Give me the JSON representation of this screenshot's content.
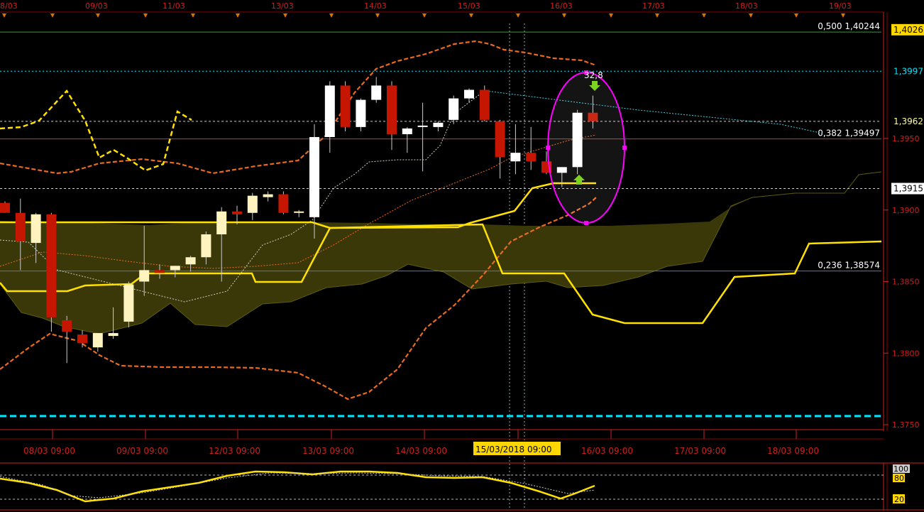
{
  "top_dates": [
    "8/03",
    "09/03",
    "11/03",
    "13/03",
    "14/03",
    "15/03",
    "16/03",
    "17/03",
    "18/03",
    "19/03"
  ],
  "bottom_dates": [
    "08/03 09:00",
    "09/03 09:00",
    "12/03 09:00",
    "13/03 09:00",
    "14/03 09:00",
    "15/03/2018 09:00",
    "16/03 09:00",
    "17/03 09:00",
    "18/03 09:00"
  ],
  "highlighted_date": "15/03/2018 09:00",
  "price_axis": {
    "ticks": [
      "1,3750",
      "1,3800",
      "1,3850",
      "1,3900",
      "1,3950"
    ],
    "tick_values": [
      1.375,
      1.38,
      1.385,
      1.39,
      1.395
    ],
    "ylim": [
      1.3745,
      1.4035
    ],
    "badges": [
      {
        "label": "1,4026",
        "value": 1.4026,
        "bg": "#ffd700",
        "fg": "#000000"
      },
      {
        "label": "1,3997",
        "value": 1.3997,
        "bg": "#000000",
        "fg": "#00e5ff"
      },
      {
        "label": "1,3962",
        "value": 1.3962,
        "bg": "#000000",
        "fg": "#ffff99"
      },
      {
        "label": "1,3915",
        "value": 1.3915,
        "bg": "#ffffff",
        "fg": "#000000"
      }
    ]
  },
  "fib_levels": [
    {
      "label": "0,500 1,40244",
      "value": 1.40244,
      "color": "#2ea02e"
    },
    {
      "label": "0,382 1,39497",
      "value": 1.39497,
      "color": "#d0342c"
    },
    {
      "label": "0,236 1,38574",
      "value": 1.38574,
      "color": "#5a6fd0"
    }
  ],
  "horizontal_lines": [
    {
      "value": 1.3997,
      "color": "#00e5ff",
      "style": "dotted"
    },
    {
      "value": 1.3962,
      "color": "#ffffff",
      "style": "dashed"
    },
    {
      "value": 1.3915,
      "color": "#ffffff",
      "style": "dashed"
    },
    {
      "value": 1.3756,
      "color": "#00e5ff",
      "style": "dashed-thick"
    }
  ],
  "annotation": {
    "text": "32,8",
    "color": "#ff00ff"
  },
  "chart_data": {
    "type": "candlestick",
    "timeframe": "4h",
    "candles": [
      {
        "x": 1,
        "o": 1.3905,
        "h": 1.3906,
        "l": 1.3898,
        "c": 1.3898
      },
      {
        "x": 2,
        "o": 1.3898,
        "h": 1.3908,
        "l": 1.3858,
        "c": 1.3878
      },
      {
        "x": 3,
        "o": 1.3877,
        "h": 1.3898,
        "l": 1.3863,
        "c": 1.3897
      },
      {
        "x": 4,
        "o": 1.3897,
        "h": 1.3898,
        "l": 1.3815,
        "c": 1.3825
      },
      {
        "x": 5,
        "o": 1.3823,
        "h": 1.3826,
        "l": 1.3793,
        "c": 1.3815
      },
      {
        "x": 6,
        "o": 1.3813,
        "h": 1.3816,
        "l": 1.3804,
        "c": 1.3807
      },
      {
        "x": 7,
        "o": 1.3804,
        "h": 1.3814,
        "l": 1.3801,
        "c": 1.3814
      },
      {
        "x": 8,
        "o": 1.3812,
        "h": 1.3832,
        "l": 1.381,
        "c": 1.3814
      },
      {
        "x": 9,
        "o": 1.3822,
        "h": 1.385,
        "l": 1.3818,
        "c": 1.3848
      },
      {
        "x": 10,
        "o": 1.385,
        "h": 1.3889,
        "l": 1.384,
        "c": 1.3858
      },
      {
        "x": 11,
        "o": 1.3858,
        "h": 1.3862,
        "l": 1.3852,
        "c": 1.3856
      },
      {
        "x": 12,
        "o": 1.3858,
        "h": 1.3861,
        "l": 1.3853,
        "c": 1.3861
      },
      {
        "x": 13,
        "o": 1.3862,
        "h": 1.3868,
        "l": 1.3857,
        "c": 1.3867
      },
      {
        "x": 14,
        "o": 1.3867,
        "h": 1.3885,
        "l": 1.3862,
        "c": 1.3883
      },
      {
        "x": 15,
        "o": 1.3883,
        "h": 1.3902,
        "l": 1.385,
        "c": 1.3899
      },
      {
        "x": 16,
        "o": 1.3899,
        "h": 1.3903,
        "l": 1.389,
        "c": 1.3897
      },
      {
        "x": 17,
        "o": 1.3898,
        "h": 1.3912,
        "l": 1.3893,
        "c": 1.391
      },
      {
        "x": 18,
        "o": 1.3909,
        "h": 1.3913,
        "l": 1.3906,
        "c": 1.3911
      },
      {
        "x": 19,
        "o": 1.3911,
        "h": 1.3913,
        "l": 1.3897,
        "c": 1.3898
      },
      {
        "x": 20,
        "o": 1.3898,
        "h": 1.39,
        "l": 1.3895,
        "c": 1.3899
      },
      {
        "x": 21,
        "o": 1.3895,
        "h": 1.396,
        "l": 1.388,
        "c": 1.3951
      },
      {
        "x": 22,
        "o": 1.3951,
        "h": 1.399,
        "l": 1.394,
        "c": 1.3987
      },
      {
        "x": 23,
        "o": 1.3987,
        "h": 1.399,
        "l": 1.3955,
        "c": 1.3958
      },
      {
        "x": 24,
        "o": 1.3958,
        "h": 1.3978,
        "l": 1.3955,
        "c": 1.3977
      },
      {
        "x": 25,
        "o": 1.3977,
        "h": 1.3993,
        "l": 1.3975,
        "c": 1.3987
      },
      {
        "x": 26,
        "o": 1.3987,
        "h": 1.399,
        "l": 1.3942,
        "c": 1.3953
      },
      {
        "x": 27,
        "o": 1.3953,
        "h": 1.3958,
        "l": 1.394,
        "c": 1.3957
      },
      {
        "x": 28,
        "o": 1.3958,
        "h": 1.3975,
        "l": 1.3927,
        "c": 1.3959
      },
      {
        "x": 29,
        "o": 1.3958,
        "h": 1.3962,
        "l": 1.3955,
        "c": 1.3961
      },
      {
        "x": 30,
        "o": 1.3963,
        "h": 1.398,
        "l": 1.396,
        "c": 1.3978
      },
      {
        "x": 31,
        "o": 1.3978,
        "h": 1.3985,
        "l": 1.3975,
        "c": 1.3984
      },
      {
        "x": 32,
        "o": 1.3984,
        "h": 1.3987,
        "l": 1.3962,
        "c": 1.3963
      },
      {
        "x": 33,
        "o": 1.3962,
        "h": 1.3963,
        "l": 1.3922,
        "c": 1.3937
      },
      {
        "x": 34,
        "o": 1.3934,
        "h": 1.396,
        "l": 1.3925,
        "c": 1.394
      },
      {
        "x": 35,
        "o": 1.394,
        "h": 1.3958,
        "l": 1.3928,
        "c": 1.3934
      },
      {
        "x": 36,
        "o": 1.3934,
        "h": 1.3941,
        "l": 1.3925,
        "c": 1.3926
      },
      {
        "x": 37,
        "o": 1.3926,
        "h": 1.393,
        "l": 1.3916,
        "c": 1.393
      },
      {
        "x": 38,
        "o": 1.393,
        "h": 1.397,
        "l": 1.3925,
        "c": 1.3968
      },
      {
        "x": 39,
        "o": 1.3968,
        "h": 1.398,
        "l": 1.3957,
        "c": 1.3962
      }
    ]
  },
  "oscillator": {
    "ticks": [
      "100",
      "80",
      "20"
    ],
    "tick_values": [
      100,
      80,
      20
    ],
    "badge_values": [
      100,
      80,
      20
    ]
  }
}
